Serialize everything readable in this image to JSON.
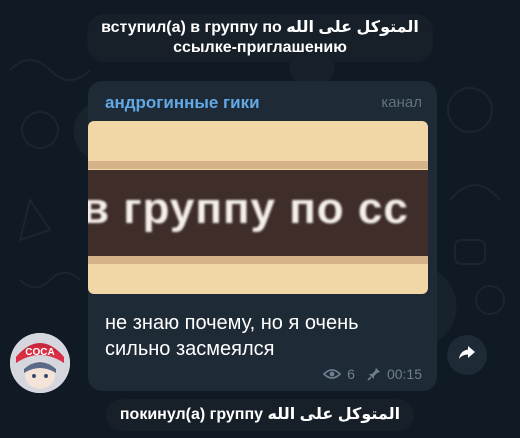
{
  "service_join": {
    "line1": "вступил(а) в группу по المتوكل على الله",
    "line2": "ссылке-приглашению"
  },
  "post": {
    "channel_name": "андрогинные гики",
    "channel_badge": "канал",
    "image_caption": "в группу по сс",
    "text_line1": "не знаю почему, но я очень",
    "text_line2": "сильно засмеялся",
    "views": "6",
    "time": "00:15"
  },
  "avatar": {
    "cap_text": "COCA"
  },
  "service_leave": {
    "text": "покинул(а) группу المتوكل على الله"
  },
  "colors": {
    "accent": "#62a8e5",
    "bubble": "#1e2a35",
    "background": "#0f1a24"
  }
}
